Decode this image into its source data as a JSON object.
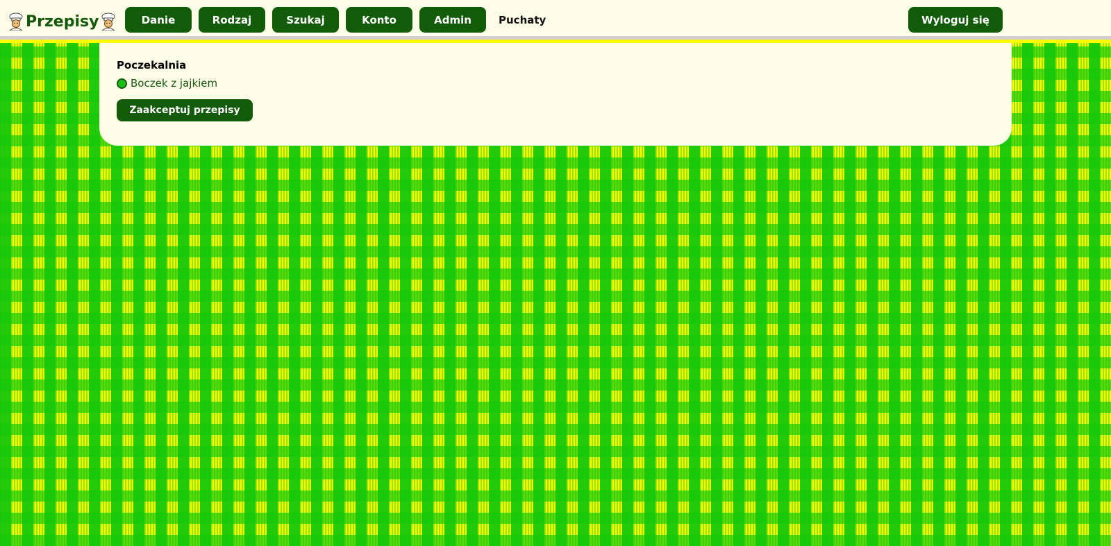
{
  "app": {
    "logo_text": "Przepisy"
  },
  "nav": {
    "items": [
      {
        "label": "Danie"
      },
      {
        "label": "Rodzaj"
      },
      {
        "label": "Szukaj"
      },
      {
        "label": "Konto"
      },
      {
        "label": "Admin"
      }
    ],
    "link_label": "Puchaty",
    "logout_label": "Wyloguj się"
  },
  "panel": {
    "title": "Poczekalnia",
    "recipes": [
      {
        "label": "Boczek z jajkiem",
        "selected": true
      }
    ],
    "accept_label": "Zaakceptuj przepisy"
  },
  "colors": {
    "primary": "#125c09",
    "background_check_a": "#ffff00",
    "background_check_b": "#14c80a",
    "panel": "#fefee8"
  },
  "icons": {
    "logo_left": "chef-icon",
    "logo_right": "chef-icon"
  }
}
